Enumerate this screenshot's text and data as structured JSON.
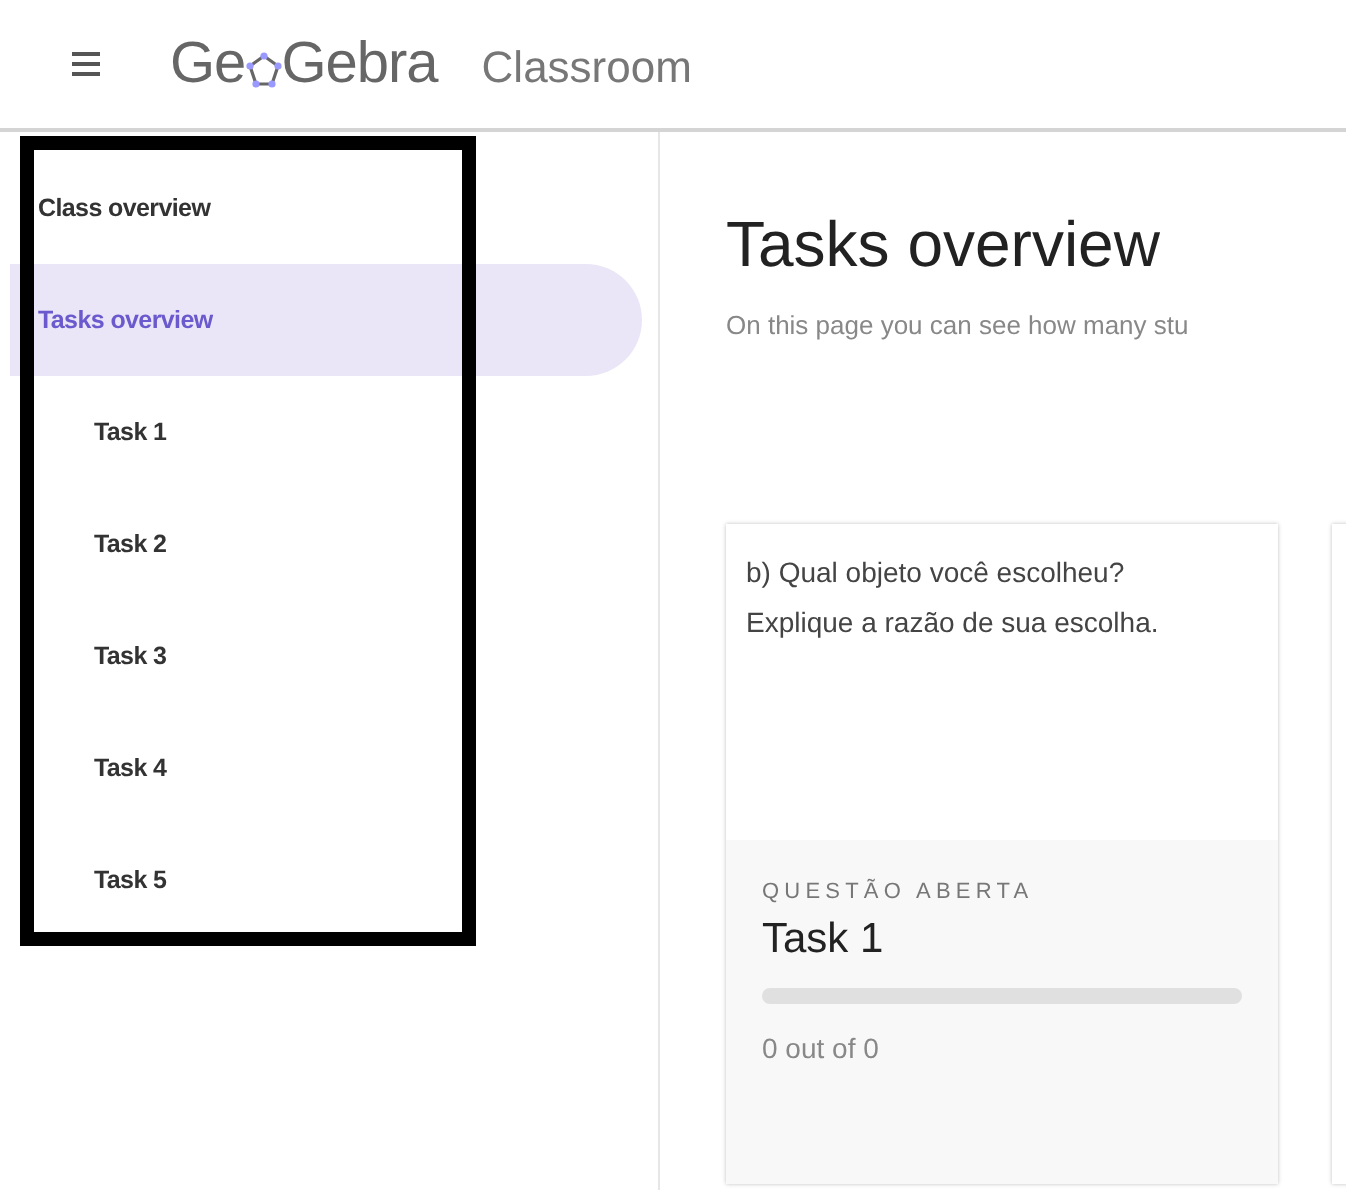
{
  "header": {
    "logo": [
      "Ge",
      "Gebra"
    ],
    "product": "Classroom"
  },
  "sidebar": {
    "items": [
      {
        "label": "Class overview",
        "selected": false
      },
      {
        "label": "Tasks overview",
        "selected": true,
        "children": [
          {
            "label": "Task 1",
            "selected": false
          },
          {
            "label": "Task 2",
            "selected": false
          },
          {
            "label": "Task 3",
            "selected": false
          },
          {
            "label": "Task 4",
            "selected": false
          },
          {
            "label": "Task 5",
            "selected": false
          }
        ]
      }
    ]
  },
  "main": {
    "title": "Tasks overview",
    "subtitle": "On this page you can see how many stu",
    "cards": [
      {
        "question": "b) Qual objeto você escolheu? Explique a razão de sua escolha.",
        "type": "QUESTÃO ABERTA",
        "name": "Task 1",
        "level": 0,
        "progress": "0 out of 0"
      }
    ]
  }
}
